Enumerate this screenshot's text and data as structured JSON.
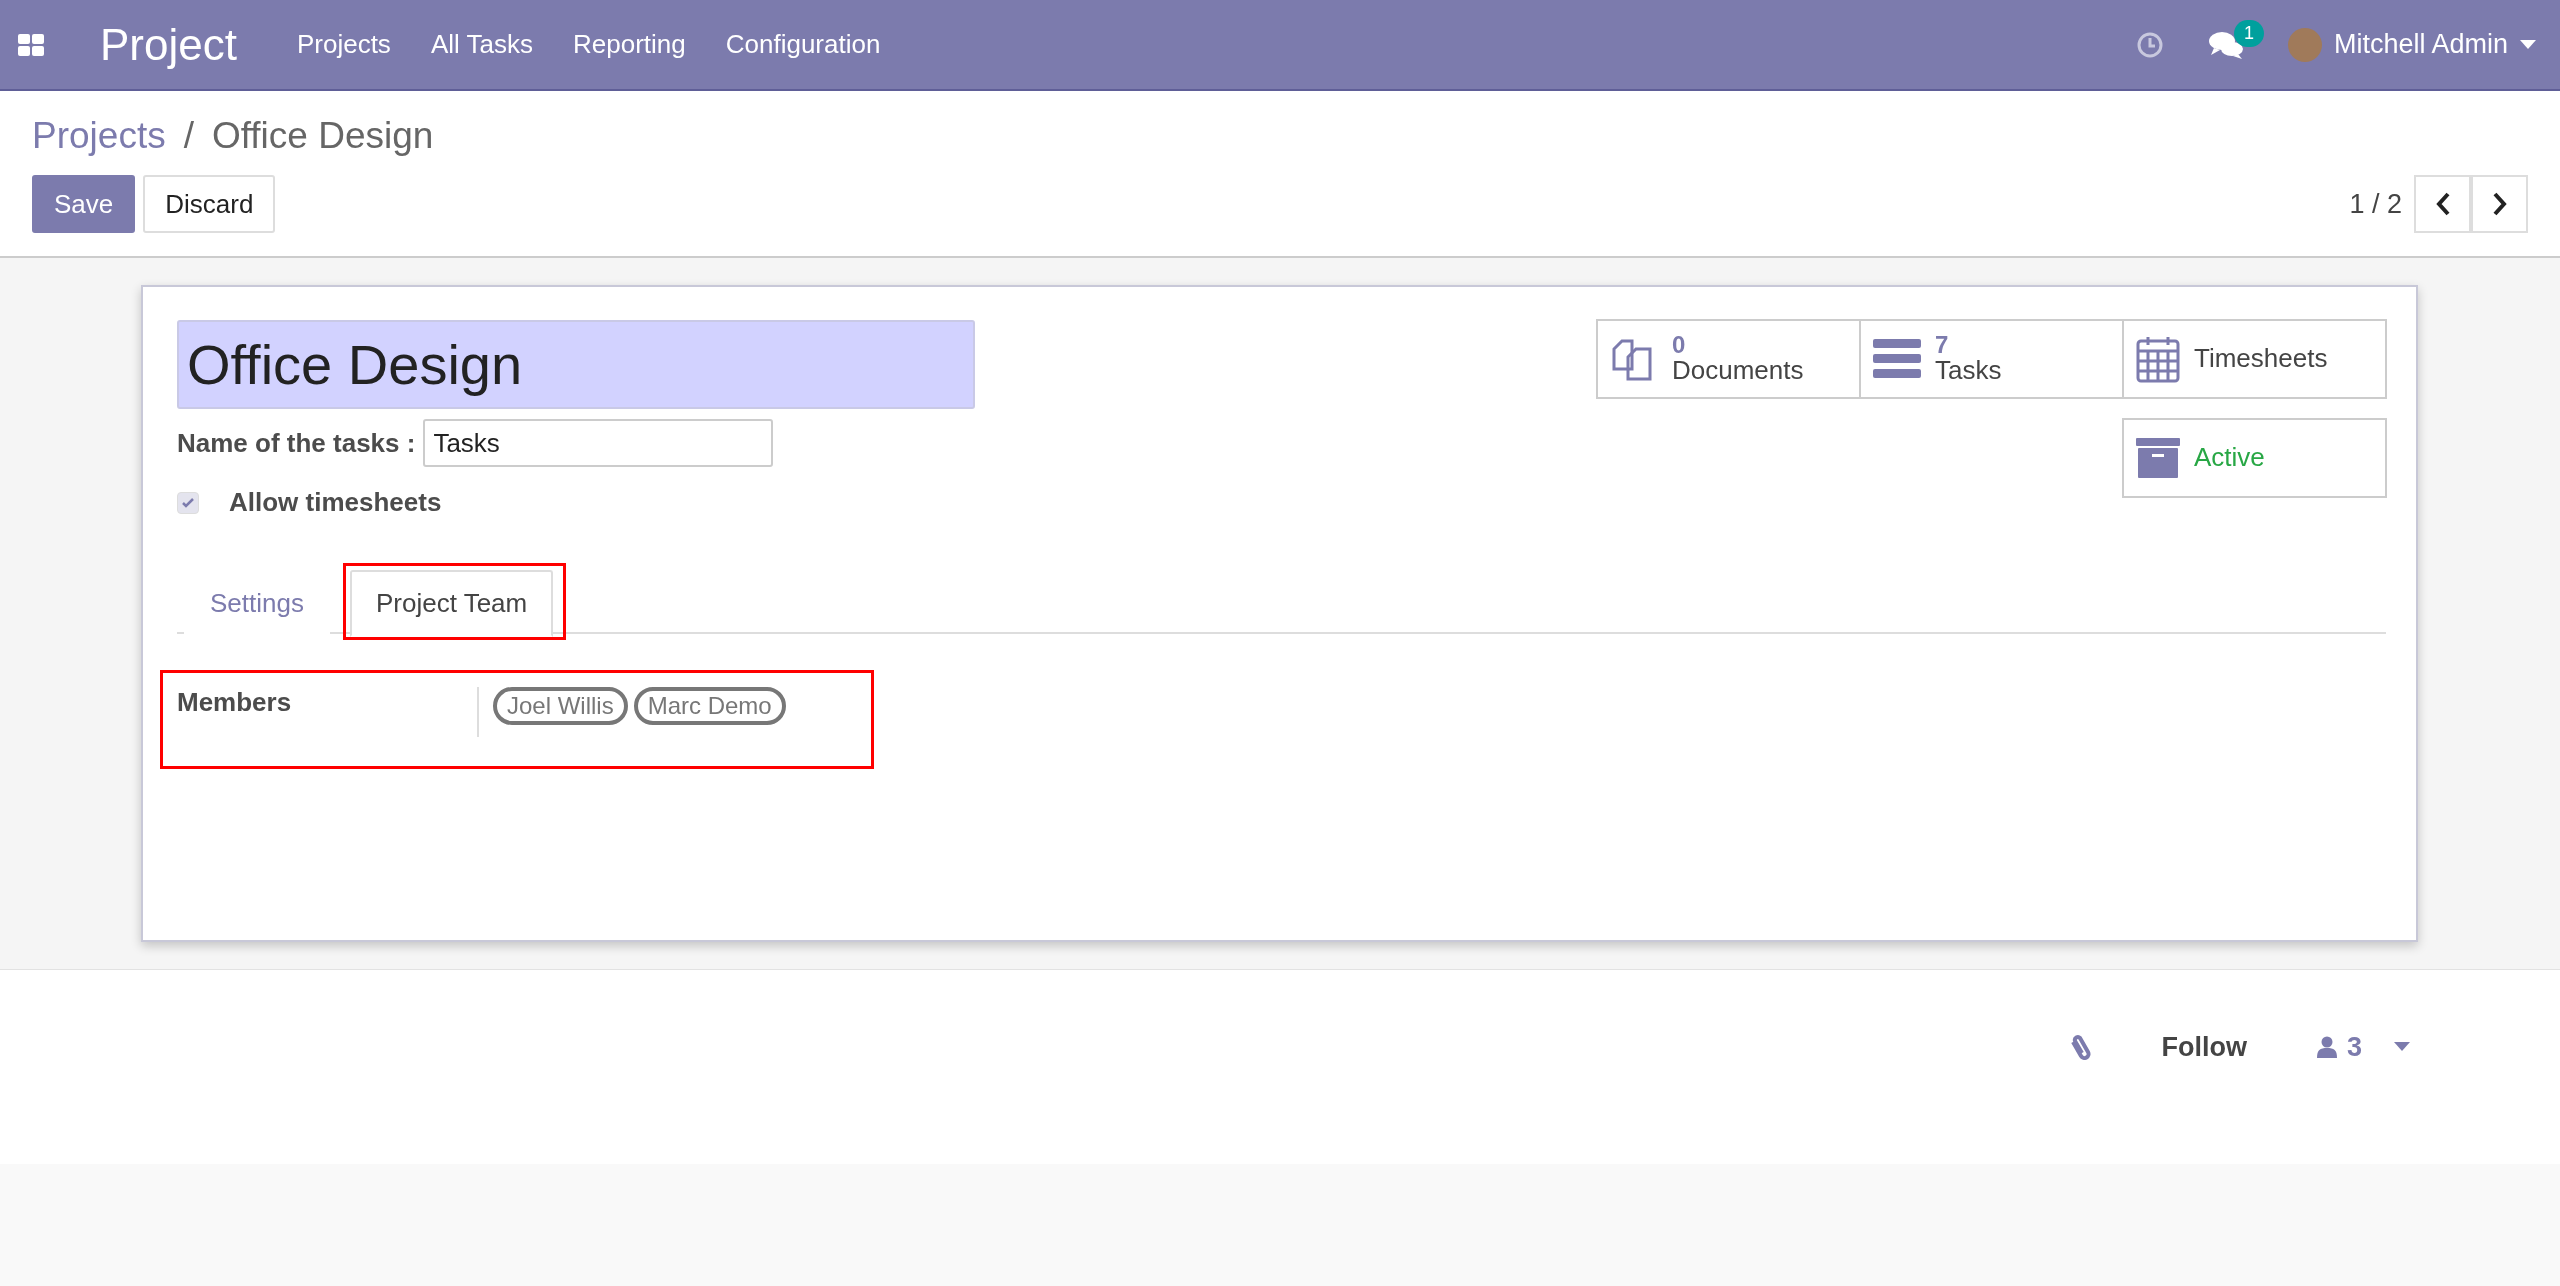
{
  "navbar": {
    "app_title": "Project",
    "menu": [
      "Projects",
      "All Tasks",
      "Reporting",
      "Configuration"
    ],
    "messages_badge": "1",
    "user": "Mitchell Admin"
  },
  "breadcrumb": {
    "parent": "Projects",
    "separator": "/",
    "current": "Office Design"
  },
  "actions": [
    "Save",
    "Discard"
  ],
  "pager": {
    "text": "1 / 2"
  },
  "form": {
    "title": "Office Design",
    "task_name_label": "Name of the tasks :",
    "task_name_value": "Tasks",
    "allow_timesheets": {
      "label": "Allow timesheets",
      "checked": true
    },
    "stat_buttons": [
      {
        "kind": "count",
        "value": "0",
        "label": "Documents"
      },
      {
        "kind": "count",
        "value": "7",
        "label": "Tasks"
      },
      {
        "kind": "label",
        "label": "Timesheets"
      },
      {
        "kind": "toggle",
        "label": "Active"
      }
    ],
    "tabs": [
      {
        "label": "Settings",
        "selected": false
      },
      {
        "label": "Project Team",
        "selected": true,
        "highlighted": true
      }
    ],
    "members": {
      "label": "Members",
      "highlighted": true,
      "tags": [
        "Joel Willis",
        "Marc Demo"
      ]
    }
  },
  "chatter": {
    "follow": "Follow",
    "followers": "3"
  }
}
